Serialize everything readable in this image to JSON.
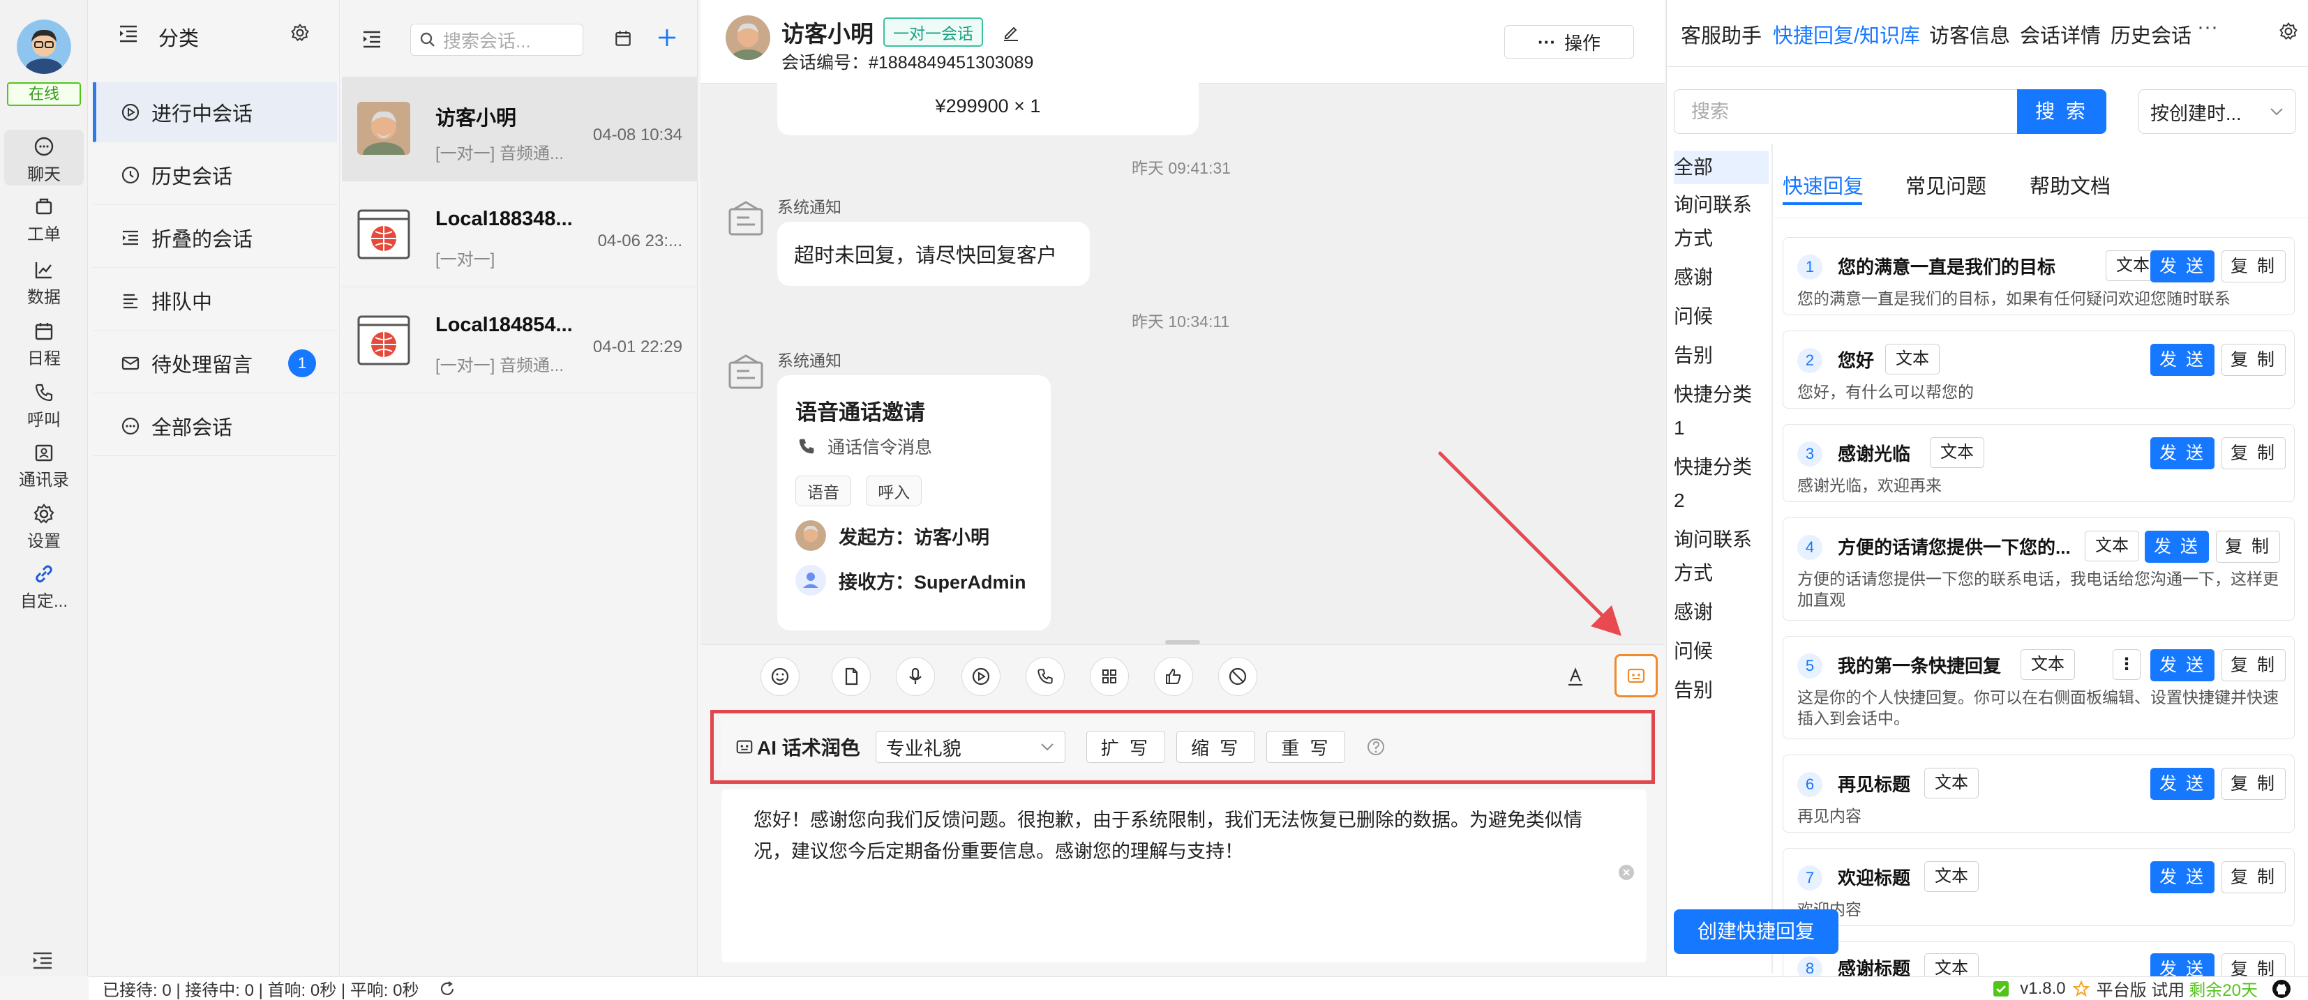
{
  "rail": {
    "status": "在线",
    "items": [
      {
        "label": "聊天",
        "icon": "chat-icon"
      },
      {
        "label": "工单",
        "icon": "ticket-icon"
      },
      {
        "label": "数据",
        "icon": "chart-icon"
      },
      {
        "label": "日程",
        "icon": "calendar-icon"
      },
      {
        "label": "呼叫",
        "icon": "phone-icon"
      },
      {
        "label": "通讯录",
        "icon": "contacts-icon"
      },
      {
        "label": "设置",
        "icon": "gear-icon"
      },
      {
        "label": "自定...",
        "icon": "link-icon"
      }
    ]
  },
  "categories": {
    "title": "分类",
    "items": [
      {
        "label": "进行中会话"
      },
      {
        "label": "历史会话"
      },
      {
        "label": "折叠的会话"
      },
      {
        "label": "排队中"
      },
      {
        "label": "待处理留言",
        "badge": "1"
      },
      {
        "label": "全部会话"
      }
    ]
  },
  "convlist": {
    "search_placeholder": "搜索会话...",
    "items": [
      {
        "name": "访客小明",
        "sub": "[一对一] 音频通...",
        "time": "04-08 10:34"
      },
      {
        "name": "Local188348...",
        "sub": "[一对一]",
        "time": "04-06 23:..."
      },
      {
        "name": "Local184854...",
        "sub": "[一对一] 音频通...",
        "time": "04-01 22:29"
      }
    ]
  },
  "chat": {
    "visitor_name": "访客小明",
    "visitor_tag": "一对一会话",
    "session_no": "会话编号：#1884849451303089",
    "op_label": "操作",
    "price_line": "¥299900 × 1",
    "ts1": "昨天 09:41:31",
    "sys_label": "系统通知",
    "msg1": "超时未回复，请尽快回复客户",
    "ts2": "昨天 10:34:11",
    "call": {
      "title": "语音通话邀请",
      "subtitle": "通话信令消息",
      "chip1": "语音",
      "chip2": "呼入",
      "from": "发起方：访客小明",
      "to": "接收方：SuperAdmin"
    },
    "ai": {
      "label": "AI 话术润色",
      "style": "专业礼貌",
      "expand": "扩 写",
      "shrink": "缩 写",
      "rewrite": "重 写"
    },
    "draft": "您好！感谢您向我们反馈问题。很抱歉，由于系统限制，我们无法恢复已删除的数据。为避免类似情况，建议您今后定期备份重要信息。感谢您的理解与支持！"
  },
  "right": {
    "tabs": [
      "客服助手",
      "快捷回复/知识库",
      "访客信息",
      "会话详情",
      "历史会话"
    ],
    "search_placeholder": "搜索",
    "search_btn": "搜 索",
    "sort": "按创建时...",
    "cats": [
      "全部",
      "询问联系",
      "方式",
      "感谢",
      "问候",
      "告别",
      "快捷分类",
      "1",
      "快捷分类",
      "2",
      "询问联系",
      "方式",
      "感谢",
      "问候",
      "告别"
    ],
    "subtabs": [
      "快速回复",
      "常见问题",
      "帮助文档"
    ],
    "send": "发 送",
    "copy": "复 制",
    "tag": "文本",
    "cards": [
      {
        "n": "1",
        "title": "您的满意一直是我们的目标",
        "body": "您的满意一直是我们的目标，如果有任何疑问欢迎您随时联系"
      },
      {
        "n": "2",
        "title": "您好",
        "body": "您好，有什么可以帮您的"
      },
      {
        "n": "3",
        "title": "感谢光临",
        "body": "感谢光临，欢迎再来"
      },
      {
        "n": "4",
        "title": "方便的话请您提供一下您的...",
        "body": "方便的话请您提供一下您的联系电话，我电话给您沟通一下，这样更加直观"
      },
      {
        "n": "5",
        "title": "我的第一条快捷回复",
        "body": "这是你的个人快捷回复。你可以在右侧面板编辑、设置快捷键并快速插入到会话中。"
      },
      {
        "n": "6",
        "title": "再见标题",
        "body": "再见内容"
      },
      {
        "n": "7",
        "title": "欢迎标题",
        "body": "欢迎内容"
      },
      {
        "n": "8",
        "title": "感谢标题",
        "body": ""
      }
    ],
    "create_btn": "创建快捷回复"
  },
  "status": {
    "stats": "已接待: 0 | 接待中: 0 | 首响: 0秒 | 平响: 0秒",
    "version": "v1.8.0",
    "edition": "平台版 试用",
    "remaining": "剩余20天"
  }
}
